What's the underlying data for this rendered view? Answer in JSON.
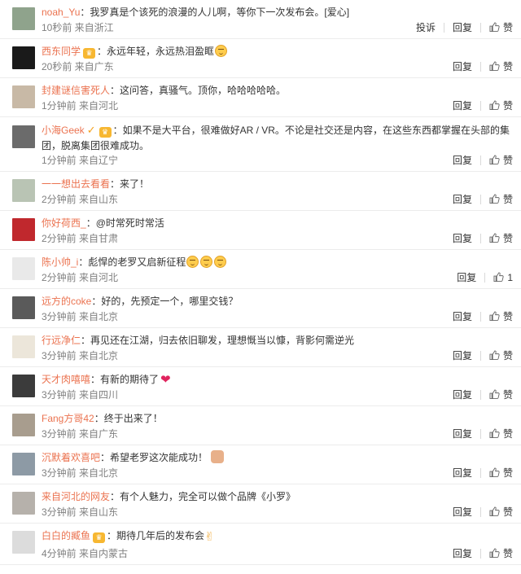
{
  "actions": {
    "report": "投诉",
    "reply": "回复",
    "like": "赞"
  },
  "comments": [
    {
      "user": "noah_Yu",
      "text": "：我罗真是个该死的浪漫的人儿啊，等你下一次发布会。[爱心]",
      "time": "10秒前 来自浙江",
      "likes": "",
      "avatar_color": "#8fa38c",
      "show_report": true
    },
    {
      "user": "西东同学",
      "badge": "vip",
      "text": "：永远年轻，永远热泪盈眶",
      "emojis": 1,
      "time": "20秒前 来自广东",
      "likes": "",
      "avatar_color": "#1a1a1a"
    },
    {
      "user": "封建谜信害死人",
      "text": "：这问答，真骚气。顶你，哈哈哈哈哈。",
      "time": "1分钟前 来自河北",
      "likes": "",
      "avatar_color": "#c8b9a6"
    },
    {
      "user": "小海Geek",
      "badge": "v+vip",
      "text": "：如果不是大平台，很难做好AR / VR。不论是社交还是内容，在这些东西都掌握在头部的集团，脱离集团很难成功。",
      "time": "1分钟前 来自辽宁",
      "likes": "",
      "avatar_color": "#6b6b6b"
    },
    {
      "user": "一一想出去看看",
      "text": "：来了！",
      "time": "2分钟前 来自山东",
      "likes": "",
      "avatar_color": "#b9c4b4"
    },
    {
      "user": "你好荷西_",
      "text": "：@时常死时常活",
      "time": "2分钟前 来自甘肃",
      "likes": "",
      "avatar_color": "#c0282d"
    },
    {
      "user": "陈小帅_i",
      "text": "：彪悍的老罗又启新征程",
      "emojis": 3,
      "time": "2分钟前 来自河北",
      "likes": "1",
      "avatar_color": "#e9e9e9"
    },
    {
      "user": "远方的coke",
      "text": "：好的，先预定一个，哪里交钱？",
      "time": "3分钟前 来自北京",
      "likes": "",
      "avatar_color": "#5a5a5a"
    },
    {
      "user": "行远净仁",
      "text": "：再见还在江湖，归去依旧聊发，理想慨当以慷，背影何需逆光",
      "time": "3分钟前 来自北京",
      "likes": "",
      "avatar_color": "#ece6da"
    },
    {
      "user": "天才肉嘻嘻",
      "text": "：有新的期待了",
      "heart": true,
      "time": "3分钟前 来自四川",
      "likes": "",
      "avatar_color": "#3b3b3b"
    },
    {
      "user": "Fang方哥42",
      "text": "：终于出来了！",
      "time": "3分钟前 来自广东",
      "likes": "",
      "avatar_color": "#a89d8e"
    },
    {
      "user": "沉默着欢喜吧",
      "text": "：希望老罗这次能成功！",
      "sticker": true,
      "time": "3分钟前 来自北京",
      "likes": "",
      "avatar_color": "#8d9aa5"
    },
    {
      "user": "来自河北的网友",
      "text": "：有个人魅力，完全可以做个品牌《小罗》",
      "time": "3分钟前 来自山东",
      "likes": "",
      "avatar_color": "#b6b1ab"
    },
    {
      "user": "白白的臧鱼",
      "badge": "vip",
      "text": "：期待几年后的发布会",
      "hand": true,
      "time": "4分钟前 来自内蒙古",
      "likes": "",
      "avatar_color": "#dcdcdc"
    }
  ]
}
